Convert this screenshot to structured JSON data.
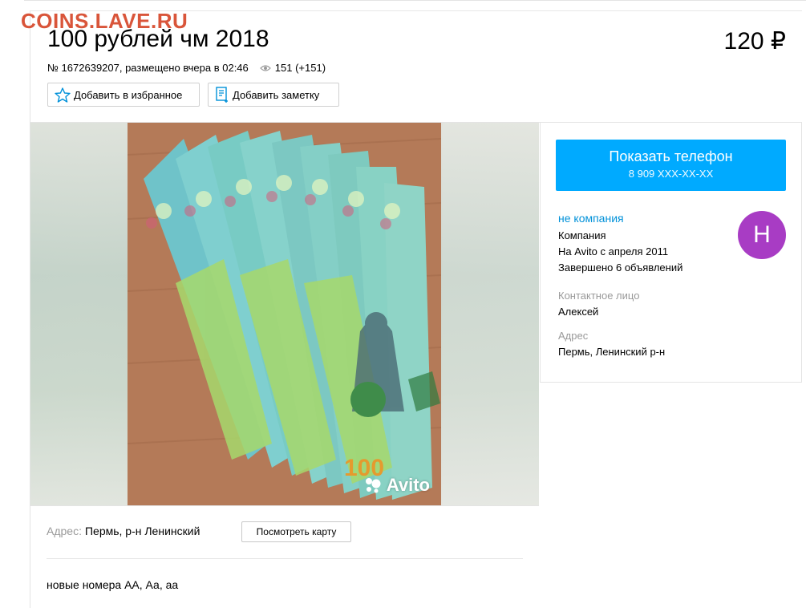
{
  "watermark": "COINS.LAVE.RU",
  "listing": {
    "title": "100 рублей чм 2018",
    "price": "120 ₽",
    "number": "№ 1672639207, размещено вчера в 02:46",
    "views": "151 (+151)"
  },
  "actions": {
    "favorite_label": "Добавить в избранное",
    "note_label": "Добавить заметку"
  },
  "gallery": {
    "watermark_text": "Avito"
  },
  "location": {
    "label": "Адрес:",
    "value": "Пермь, р-н Ленинский",
    "map_button": "Посмотреть карту"
  },
  "description": "новые номера АА, Аа, аа",
  "sidebar": {
    "phone_button_title": "Показать телефон",
    "phone_button_number": "8 909 XXX-XX-XX",
    "seller_type": "не компания",
    "company_line": "Компания",
    "since": "На Avito с апреля 2011",
    "completed": "Завершено 6 объявлений",
    "avatar_letter": "Н",
    "avatar_color": "#a83cc4",
    "contact_label": "Контактное лицо",
    "contact_name": "Алексей",
    "address_label": "Адрес",
    "address_value": "Пермь, Ленинский р-н"
  },
  "colors": {
    "accent": "#00aaff",
    "link": "#0091d9",
    "watermark": "#d9553a"
  }
}
